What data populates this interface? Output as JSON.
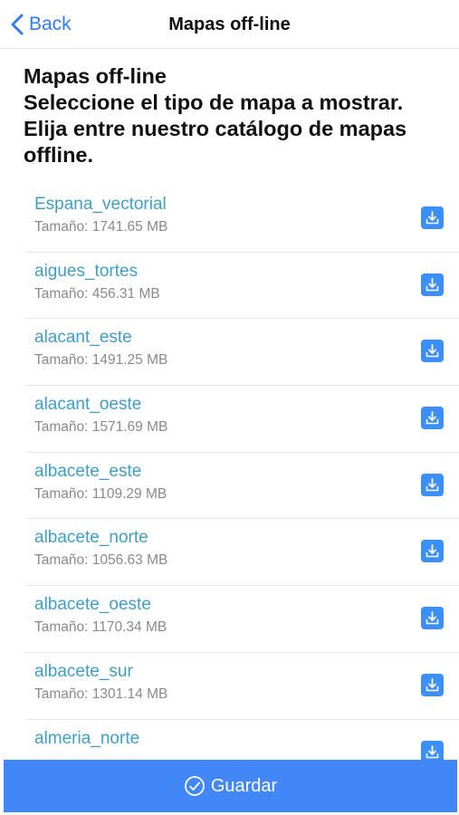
{
  "nav": {
    "back_label": "Back",
    "title": "Mapas off-line"
  },
  "header": {
    "lines": [
      "Mapas off-line",
      "Seleccione el tipo de mapa a mostrar.",
      "Elija entre nuestro catálogo de mapas offline."
    ]
  },
  "maps": [
    {
      "name": "Espana_vectorial",
      "size": "Tamaño: 1741.65 MB"
    },
    {
      "name": "aigues_tortes",
      "size": "Tamaño: 456.31 MB"
    },
    {
      "name": "alacant_este",
      "size": "Tamaño: 1491.25 MB"
    },
    {
      "name": "alacant_oeste",
      "size": "Tamaño: 1571.69 MB"
    },
    {
      "name": "albacete_este",
      "size": "Tamaño: 1109.29 MB"
    },
    {
      "name": "albacete_norte",
      "size": "Tamaño: 1056.63 MB"
    },
    {
      "name": "albacete_oeste",
      "size": "Tamaño: 1170.34 MB"
    },
    {
      "name": "albacete_sur",
      "size": "Tamaño: 1301.14 MB"
    },
    {
      "name": "almeria_norte",
      "size": ""
    }
  ],
  "icons": {
    "back": "chevron-left-icon",
    "download": "download-icon",
    "save": "check-circle-icon"
  },
  "colors": {
    "accent": "#2f7cf6",
    "link": "#3f9fc8",
    "button": "#4187f8"
  },
  "footer": {
    "save_label": "Guardar"
  }
}
